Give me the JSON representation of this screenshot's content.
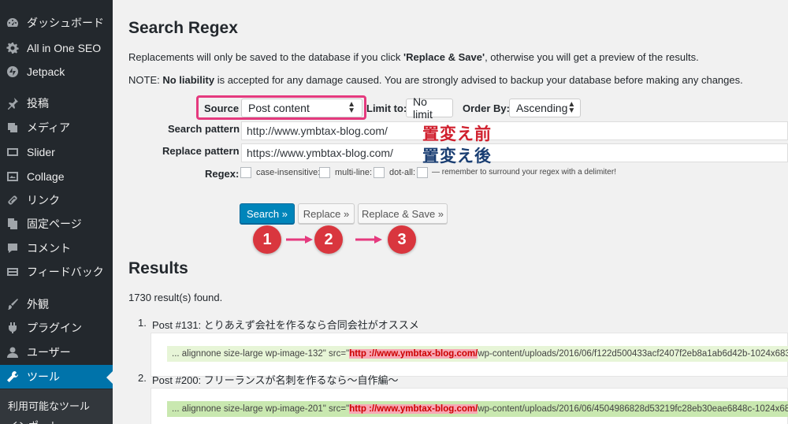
{
  "colors": {
    "sidebar_bg": "#23282d",
    "active": "#0073aa",
    "primary_btn": "#0085ba",
    "annotation_red": "#d9363e",
    "annotation_pink": "#e53a7e",
    "match_bg_1": "#e7f5d7",
    "match_bg_2": "#c9e8b0",
    "highlight": "#f7a8b5"
  },
  "sidebar": {
    "items": [
      {
        "label": "ダッシュボード",
        "icon": "dashboard-icon"
      },
      {
        "label": "All in One SEO",
        "icon": "gear-icon"
      },
      {
        "label": "Jetpack",
        "icon": "jetpack-icon"
      },
      {
        "label": "投稿",
        "icon": "pin-icon"
      },
      {
        "label": "メディア",
        "icon": "media-icon"
      },
      {
        "label": "Slider",
        "icon": "slider-icon"
      },
      {
        "label": "Collage",
        "icon": "collage-icon"
      },
      {
        "label": "リンク",
        "icon": "link-icon"
      },
      {
        "label": "固定ページ",
        "icon": "pages-icon"
      },
      {
        "label": "コメント",
        "icon": "comment-icon"
      },
      {
        "label": "フィードバック",
        "icon": "feedback-icon"
      },
      {
        "label": "外観",
        "icon": "brush-icon"
      },
      {
        "label": "プラグイン",
        "icon": "plugin-icon"
      },
      {
        "label": "ユーザー",
        "icon": "user-icon"
      },
      {
        "label": "ツール",
        "icon": "wrench-icon",
        "active": true
      }
    ],
    "submenu": [
      "利用可能なツール",
      "インポート"
    ]
  },
  "page": {
    "title": "Search Regex",
    "note1_pre": "Replacements will only be saved to the database if you click ",
    "note1_bold": "'Replace & Save'",
    "note1_post": ", otherwise you will get a preview of the results.",
    "note2_pre": "NOTE: ",
    "note2_bold": "No liability",
    "note2_post": " is accepted for any damage caused. You are strongly advised to backup your database before making any changes."
  },
  "form": {
    "source_label": "Source",
    "source_value": "Post content",
    "limit_label": "Limit to:",
    "limit_value": "No limit",
    "order_label": "Order By:",
    "order_value": "Ascending",
    "search_label": "Search pattern",
    "search_value": "http://www.ymbtax-blog.com/",
    "replace_label": "Replace pattern",
    "replace_value": "https://www.ymbtax-blog.com/",
    "regex_label": "Regex:",
    "opt_case": "case-insensitive:",
    "opt_multi": "multi-line:",
    "opt_dot": "dot-all:",
    "regex_hint": "— remember to surround your regex with a delimiter!"
  },
  "annotations": {
    "before": "置変え前",
    "after": "置変え後",
    "step1": "1",
    "step2": "2",
    "step3": "3"
  },
  "buttons": {
    "search": "Search »",
    "replace": "Replace »",
    "replace_save": "Replace & Save »"
  },
  "results": {
    "title": "Results",
    "count": "1730 result(s) found.",
    "items": [
      {
        "num": "1.",
        "title": "Post #131: とりあえず会社を作るなら合同会社がオススメ",
        "pre": "... alignnone size-large wp-image-132\" src=\"",
        "match": "http ://www.ymbtax-blog.com/",
        "post": "wp-content/uploads/2016/06/f122d500433acf2407f2eb8a1ab6d42b-1024x683"
      },
      {
        "num": "2.",
        "title": "Post #200: フリーランスが名刺を作るなら〜自作編〜",
        "pre": "... alignnone size-large wp-image-201\" src=\"",
        "match": "http ://www.ymbtax-blog.com/",
        "post": "wp-content/uploads/2016/06/4504986828d53219fc28eb30eae6848c-1024x68"
      }
    ]
  }
}
